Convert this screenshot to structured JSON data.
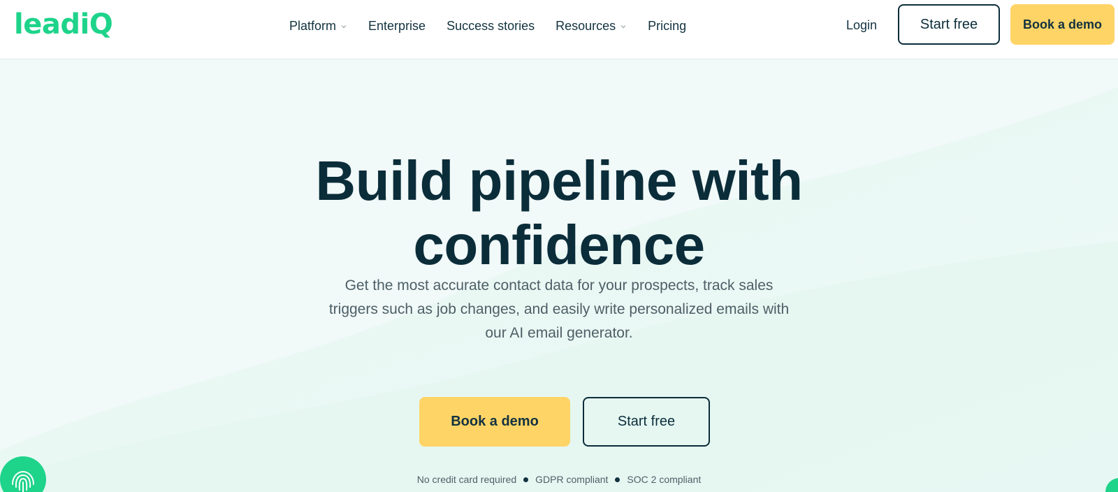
{
  "header": {
    "logo_text": "leadi",
    "logo_q": "Q",
    "nav": [
      {
        "label": "Platform",
        "has_dropdown": true
      },
      {
        "label": "Enterprise",
        "has_dropdown": false
      },
      {
        "label": "Success stories",
        "has_dropdown": false
      },
      {
        "label": "Resources",
        "has_dropdown": true
      },
      {
        "label": "Pricing",
        "has_dropdown": false
      }
    ],
    "login": "Login",
    "start_free": "Start free",
    "book_demo": "Book a demo"
  },
  "hero": {
    "headline_line1": "Build pipeline with",
    "headline_line2": "confidence",
    "subtext": "Get the most accurate contact data for your prospects, track sales triggers such as job changes, and easily write personalized emails with our AI email generator.",
    "book_demo": "Book a demo",
    "start_free": "Start free",
    "badges": [
      "No credit card required",
      "GDPR compliant",
      "SOC 2 compliant"
    ]
  },
  "colors": {
    "brand_green": "#1ed38a",
    "dark_navy": "#0b2d3a",
    "cta_yellow": "#ffd466",
    "hero_bg": "#f1f9f9"
  },
  "icons": {
    "chevron": "chevron-down-icon",
    "fingerprint": "fingerprint-icon"
  }
}
